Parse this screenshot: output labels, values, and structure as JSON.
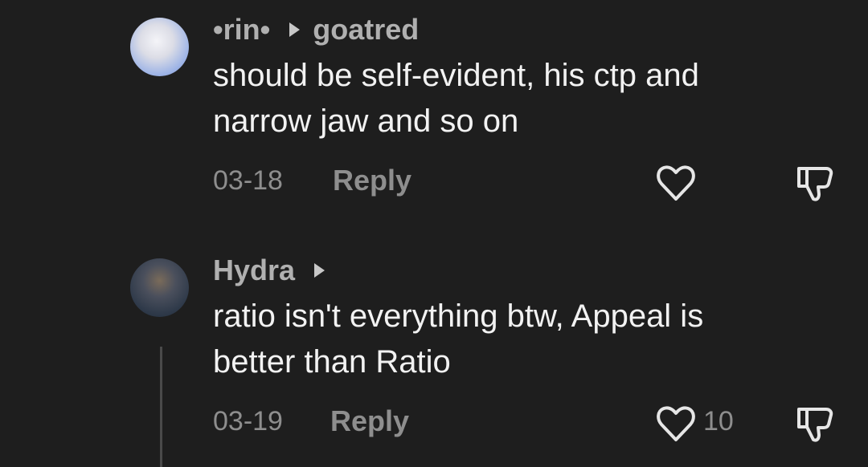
{
  "comments": [
    {
      "author": "•rin•",
      "reply_to": "goatred",
      "text_line1": "should be self-evident, his ctp and",
      "text_line2": "narrow jaw and so on",
      "date": "03-18",
      "reply_label": "Reply",
      "like_count": ""
    },
    {
      "author": "Hydra",
      "reply_to": "",
      "text_line1": "ratio isn't everything btw, Appeal is",
      "text_line2": "better than Ratio",
      "date": "03-19",
      "reply_label": "Reply",
      "like_count": "10"
    }
  ],
  "icons": {
    "like": "heart-outline-icon",
    "dislike": "thumbs-down-outline-icon",
    "reply_arrow": "play-triangle-icon"
  },
  "colors": {
    "background": "#1e1e1e",
    "text": "#f2f2f2",
    "muted": "#8e8e8e",
    "author": "#b0b0b0"
  }
}
